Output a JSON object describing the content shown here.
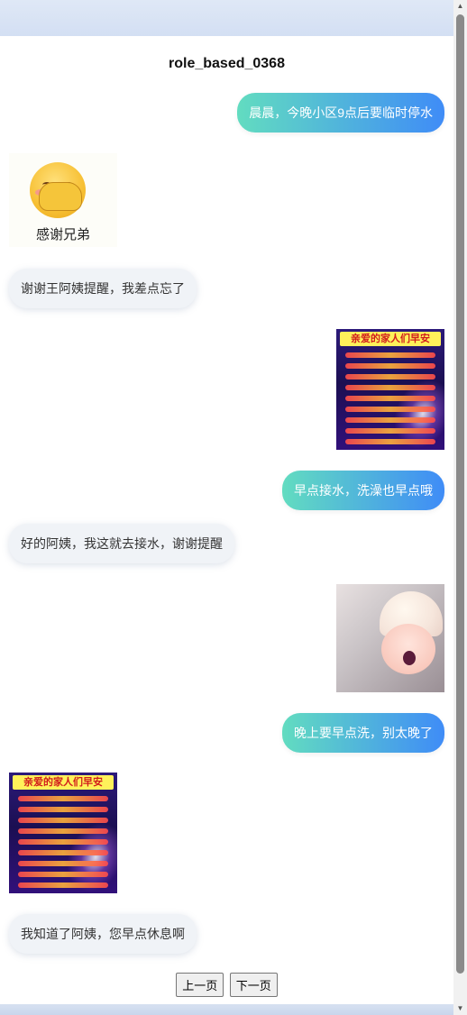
{
  "title": "role_based_0368",
  "messages": [
    {
      "side": "right",
      "type": "text",
      "text": "晨晨，今晚小区9点后要临时停水"
    },
    {
      "side": "left",
      "type": "image",
      "image": "emoji-sticker",
      "caption": "感谢兄弟"
    },
    {
      "side": "left",
      "type": "text",
      "text": "谢谢王阿姨提醒，我差点忘了"
    },
    {
      "side": "right",
      "type": "image",
      "image": "greeting-card",
      "caption": "亲爱的家人们早安"
    },
    {
      "side": "right",
      "type": "text",
      "text": "早点接水，洗澡也早点哦"
    },
    {
      "side": "left",
      "type": "text",
      "text": "好的阿姨，我这就去接水，谢谢提醒"
    },
    {
      "side": "right",
      "type": "image",
      "image": "doll-photo"
    },
    {
      "side": "right",
      "type": "text",
      "text": "晚上要早点洗，别太晚了"
    },
    {
      "side": "left",
      "type": "image",
      "image": "greeting-card",
      "caption": "亲爱的家人们早安"
    },
    {
      "side": "left",
      "type": "text",
      "text": "我知道了阿姨，您早点休息啊"
    }
  ],
  "pager": {
    "prev_label": "上一页",
    "next_label": "下一页"
  },
  "colors": {
    "bubble_right_start": "#62dcc0",
    "bubble_right_end": "#3f8cf7",
    "bubble_left": "#f0f3f7"
  }
}
